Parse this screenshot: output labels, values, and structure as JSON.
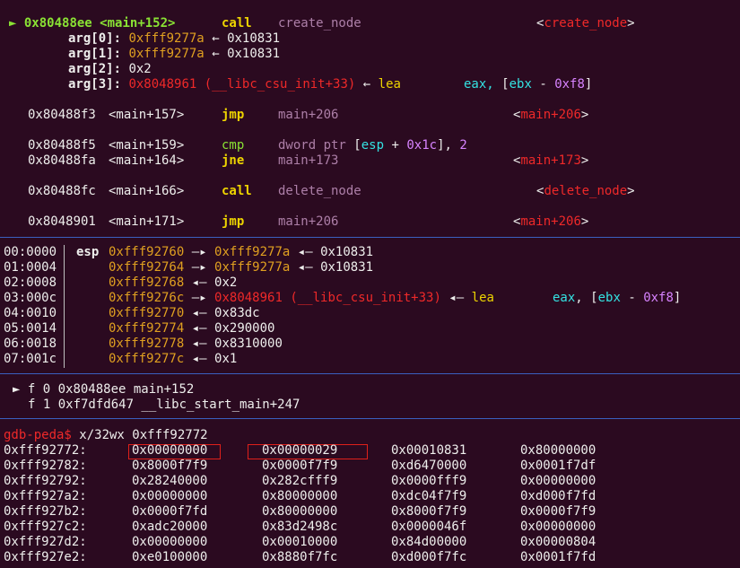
{
  "code": {
    "cur": {
      "marker": "►",
      "addr": "0x80488ee",
      "sym": "<main+152>",
      "mn": "call",
      "op": "create_node",
      "target": "<create_node>"
    },
    "args": [
      {
        "label": "arg[0]:",
        "val": "0xfff9277a",
        "arrow": "←",
        "res": "0x10831"
      },
      {
        "label": "arg[1]:",
        "val": "0xfff9277a",
        "arrow": "←",
        "res": "0x10831"
      },
      {
        "label": "arg[2]:",
        "plain": "0x2"
      },
      {
        "label": "arg[3]:",
        "val": "0x8048961",
        "sym": "(__libc_csu_init+33)",
        "arrow": "←",
        "mn": "lea",
        "op1": "eax,",
        "op2a": "[ebx",
        "op2b": "-",
        "op2c": "0xf8]"
      }
    ],
    "lines": [
      {
        "addr": "0x80488f3",
        "sym": "<main+157>",
        "mn": "jmp",
        "op": "main+206",
        "target": "<main+206>"
      },
      {
        "addr": "0x80488f5",
        "sym": "<main+159>",
        "mn": "cmp",
        "op": "dword ptr [esp + 0x1c], 2",
        "target": ""
      },
      {
        "addr": "0x80488fa",
        "sym": "<main+164>",
        "mn": "jne",
        "op": "main+173",
        "target": "<main+173>"
      },
      {
        "addr": "0x80488fc",
        "sym": "<main+166>",
        "mn": "call",
        "op": "delete_node",
        "target": "<delete_node>"
      },
      {
        "addr": "0x8048901",
        "sym": "<main+171>",
        "mn": "jmp",
        "op": "main+206",
        "target": "<main+206>"
      }
    ]
  },
  "stack": [
    {
      "off": "00:0000",
      "reg": "esp",
      "addr": "0xfff92760",
      "arrow": "—▸",
      "ptr": "0xfff9277a",
      "arrow2": "◂—",
      "val": "0x10831"
    },
    {
      "off": "01:0004",
      "reg": "",
      "addr": "0xfff92764",
      "arrow": "—▸",
      "ptr": "0xfff9277a",
      "arrow2": "◂—",
      "val": "0x10831"
    },
    {
      "off": "02:0008",
      "reg": "",
      "addr": "0xfff92768",
      "arrow": "◂—",
      "val": "0x2"
    },
    {
      "off": "03:000c",
      "reg": "",
      "addr": "0xfff9276c",
      "arrow": "—▸",
      "code": "0x8048961 (__libc_csu_init+33)",
      "arrow2": "◂—",
      "mn": "lea",
      "ins": "eax, [ebx - 0xf8]"
    },
    {
      "off": "04:0010",
      "reg": "",
      "addr": "0xfff92770",
      "arrow": "◂—",
      "val": "0x83dc"
    },
    {
      "off": "05:0014",
      "reg": "",
      "addr": "0xfff92774",
      "arrow": "◂—",
      "val": "0x290000"
    },
    {
      "off": "06:0018",
      "reg": "",
      "addr": "0xfff92778",
      "arrow": "◂—",
      "val": "0x8310000"
    },
    {
      "off": "07:001c",
      "reg": "",
      "addr": "0xfff9277c",
      "arrow": "◂—",
      "val": "0x1"
    }
  ],
  "backtrace": [
    {
      "marker": "►",
      "text": "f 0 0x80488ee main+152"
    },
    {
      "marker": "",
      "text": "f 1 0xf7dfd647 __libc_start_main+247"
    }
  ],
  "prompt": {
    "ps": "gdb-peda$",
    "cmd": " x/32wx 0xfff92772"
  },
  "dump": [
    {
      "a": "0xfff92772:",
      "w": [
        "0x00000000",
        "0x00000029",
        "0x00010831",
        "0x80000000"
      ]
    },
    {
      "a": "0xfff92782:",
      "w": [
        "0x8000f7f9",
        "0x0000f7f9",
        "0xd6470000",
        "0x0001f7df"
      ]
    },
    {
      "a": "0xfff92792:",
      "w": [
        "0x28240000",
        "0x282cfff9",
        "0x0000fff9",
        "0x00000000"
      ]
    },
    {
      "a": "0xfff927a2:",
      "w": [
        "0x00000000",
        "0x80000000",
        "0xdc04f7f9",
        "0xd000f7fd"
      ]
    },
    {
      "a": "0xfff927b2:",
      "w": [
        "0x0000f7fd",
        "0x80000000",
        "0x8000f7f9",
        "0x0000f7f9"
      ]
    },
    {
      "a": "0xfff927c2:",
      "w": [
        "0xadc20000",
        "0x83d2498c",
        "0x0000046f",
        "0x00000000"
      ]
    },
    {
      "a": "0xfff927d2:",
      "w": [
        "0x00000000",
        "0x00010000",
        "0x84d00000",
        "0x00000804"
      ]
    },
    {
      "a": "0xfff927e2:",
      "w": [
        "0xe0100000",
        "0x8880f7fc",
        "0xd000f7fc",
        "0x0001f7fd"
      ]
    }
  ],
  "colors": {
    "bg": "#2b0a20",
    "separator": "#3a5fbf",
    "highlight_box": "#e0201a"
  }
}
